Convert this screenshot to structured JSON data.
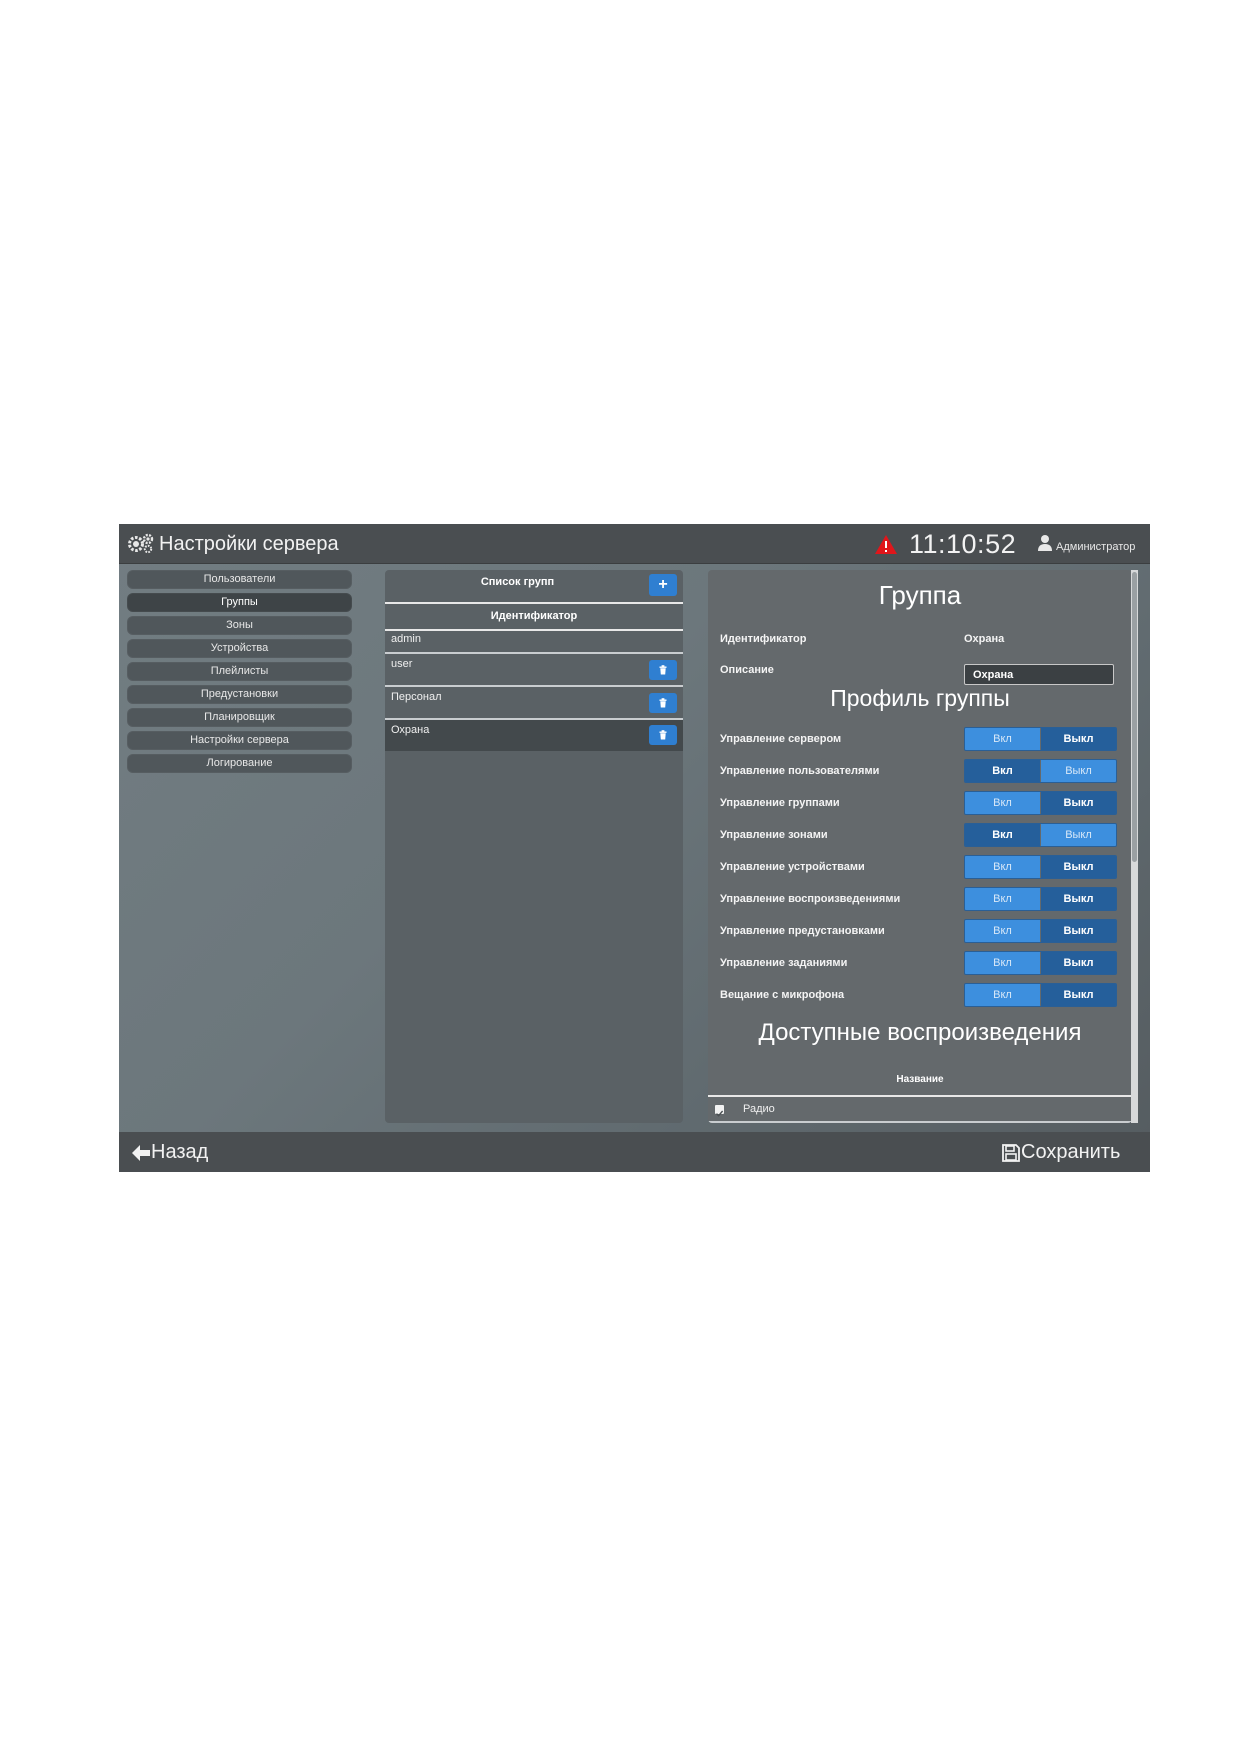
{
  "header": {
    "title": "Настройки сервера",
    "clock": "11:10:52",
    "user": "Администратор",
    "icons": [
      "gears-icon",
      "warning-icon",
      "user-icon"
    ],
    "warning_color": "#e0161b"
  },
  "sidebar": {
    "items": [
      {
        "label": "Пользователи",
        "active": false
      },
      {
        "label": "Группы",
        "active": true
      },
      {
        "label": "Зоны",
        "active": false
      },
      {
        "label": "Устройства",
        "active": false
      },
      {
        "label": "Плейлисты",
        "active": false
      },
      {
        "label": "Предустановки",
        "active": false
      },
      {
        "label": "Планировщик",
        "active": false
      },
      {
        "label": "Настройки сервера",
        "active": false
      },
      {
        "label": "Логирование",
        "active": false
      }
    ]
  },
  "group_list": {
    "title": "Список групп",
    "add_label": "+",
    "column_header": "Идентификатор",
    "rows": [
      {
        "name": "admin",
        "deletable": false,
        "selected": false
      },
      {
        "name": "user",
        "deletable": true,
        "selected": false
      },
      {
        "name": "Персонал",
        "deletable": true,
        "selected": false
      },
      {
        "name": "Охрана",
        "deletable": true,
        "selected": true
      }
    ]
  },
  "group": {
    "title": "Группа",
    "id_label": "Идентификатор",
    "id_value": "Охрана",
    "desc_label": "Описание",
    "desc_value": "Охрана",
    "profile_title": "Профиль группы",
    "on_label": "Вкл",
    "off_label": "Выкл",
    "permissions": [
      {
        "label": "Управление сервером",
        "state": "off"
      },
      {
        "label": "Управление пользователями",
        "state": "on"
      },
      {
        "label": "Управление группами",
        "state": "off"
      },
      {
        "label": "Управление зонами",
        "state": "on"
      },
      {
        "label": "Управление устройствами",
        "state": "off"
      },
      {
        "label": "Управление воспроизведениями",
        "state": "off"
      },
      {
        "label": "Управление предустановками",
        "state": "off"
      },
      {
        "label": "Управление заданиями",
        "state": "off"
      },
      {
        "label": "Вещание с микрофона",
        "state": "off"
      }
    ],
    "available_title": "Доступные воспроизведения",
    "available_column": "Название",
    "available_rows": [
      {
        "name": "Радио",
        "checked": true
      }
    ]
  },
  "footer": {
    "back_label": "Назад",
    "save_label": "Сохранить",
    "icons": [
      "arrow-left-icon",
      "floppy-disk-icon"
    ]
  },
  "colors": {
    "accent": "#2f7fd1",
    "toggle_active": "#255f9b",
    "toggle_inactive": "#3d8fde"
  }
}
